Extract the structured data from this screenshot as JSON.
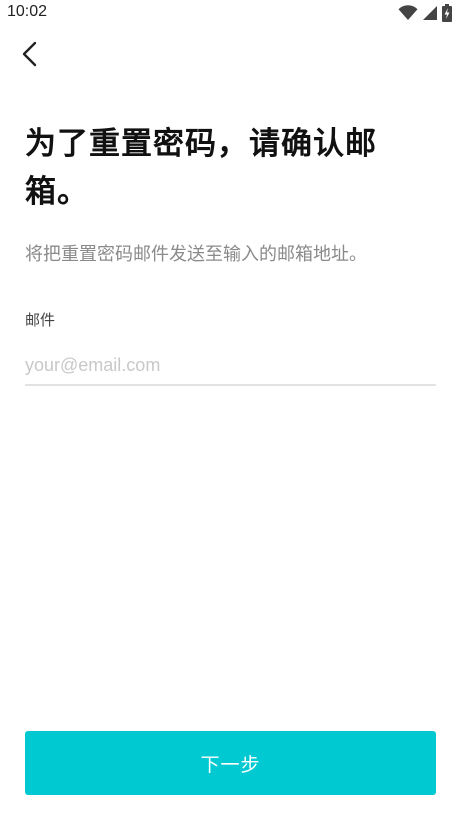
{
  "status_bar": {
    "time": "10:02",
    "icons": [
      "wifi-icon",
      "cellular-signal-icon",
      "battery-charging-icon"
    ]
  },
  "header": {
    "back_icon": "chevron-left-icon"
  },
  "main": {
    "title": "为了重置密码，请确认邮箱。",
    "subtitle": "将把重置密码邮件发送至输入的邮箱地址。",
    "email_label": "邮件",
    "email_placeholder": "your@email.com",
    "email_value": ""
  },
  "footer": {
    "next_label": "下一步"
  },
  "colors": {
    "accent": "#00c9d2",
    "title": "#111111",
    "subtitle": "#8a8a8a",
    "placeholder": "#c8c8c8",
    "divider": "#e2e2e2"
  }
}
